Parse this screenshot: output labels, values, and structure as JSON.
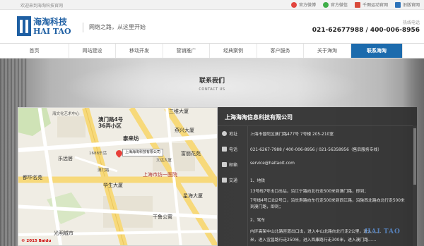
{
  "topbar": {
    "welcome": "欢迎来到海淘科技官网",
    "links": [
      {
        "label": "官方微博",
        "icon": "weibo-icon",
        "color": "#e2463f"
      },
      {
        "label": "官方微信",
        "icon": "wechat-icon",
        "color": "#3fae49"
      },
      {
        "label": "千图运动官网",
        "icon": "qiantu-icon",
        "color": "#d84a3a"
      },
      {
        "label": "旧版官网",
        "icon": "old-site-icon",
        "color": "#2d73b9"
      }
    ]
  },
  "header": {
    "logo_cn": "海淘科技",
    "logo_en": "HAI TAO",
    "slogan": "网络之路，从这里开始",
    "hotline_label": "热线电话",
    "hotline": "021-62677988 / 400-006-8956"
  },
  "nav": {
    "items": [
      {
        "label": "首页",
        "active": false
      },
      {
        "label": "网站建设",
        "active": false
      },
      {
        "label": "移动开发",
        "active": false
      },
      {
        "label": "营销推广",
        "active": false
      },
      {
        "label": "经典案例",
        "active": false
      },
      {
        "label": "客户服务",
        "active": false
      },
      {
        "label": "关于海淘",
        "active": false
      },
      {
        "label": "联系海淘",
        "active": true
      }
    ]
  },
  "page": {
    "title_cn": "联系我们",
    "title_en": "CONTACT US"
  },
  "map": {
    "labels": {
      "rest_area": "澳门路4号\n36弄小区",
      "sanxiang": "三维大厦",
      "yanxing": "燕兴大厦",
      "tailaifang": "泰来坊",
      "fuli": "富丽花苑",
      "leyuanju": "乐远居",
      "hospital": "上海市纺一医院",
      "xinghai": "星海大厦",
      "duhua": "都华名苑",
      "huasheng": "华生大厦",
      "ganqing": "干鲁公寓",
      "guangming": "光明城市",
      "wenhua": "海文化艺术中心",
      "yuanyuan": "文远大厦",
      "hotel_info": "上海海淘科技有限公司",
      "baidu": "© 2015 Baidu",
      "road1": "1688乐活",
      "road2": "澳门路"
    }
  },
  "contact": {
    "company": "上海海淘信息科技有限公司",
    "address_label": "地址",
    "address": "上海市普陀区澳门路477号 7号楼 205-210室",
    "phone_label": "电话",
    "phone": "021-6267-7988 / 400-006-8956 / 021-56358956（售后服务专线）",
    "email_label": "邮箱",
    "email": "service@haitaoit.com",
    "traffic_label": "交通",
    "traffic_lines": [
      "1、地铁",
      "13号线7号出口出站，沿江宁路向北行走500米到澳门路，即到；",
      "7号线4号口出2号口，沿长寿路向东行走500米到西江路，沿陕西北路向北行走500米到澳门路，即到；",
      "2、驾车",
      "内环高架中山北路匝道出口出，进入中山北路向北行走2公里，进入 ……",
      "米，进入宜昌路行走250米，进入西康路行走300米，进入澳门路……"
    ]
  },
  "watermark": "HAI TAO"
}
